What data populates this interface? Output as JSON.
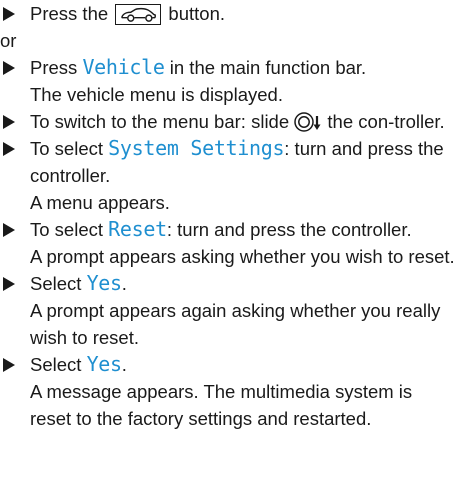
{
  "steps": [
    {
      "before": "Press the ",
      "icon": "car-icon",
      "after": " button."
    },
    {
      "or": "or"
    },
    {
      "before": "Press ",
      "ui": "Vehicle",
      "after": " in the main function bar.",
      "result": "The vehicle menu is displayed."
    },
    {
      "before": "To switch to the menu bar: slide ",
      "icon": "controller-slide-down-icon",
      "after": " the con-troller."
    },
    {
      "before": "To select ",
      "ui": "System Settings",
      "after": ": turn and press the controller.",
      "result": "A menu appears."
    },
    {
      "before": "To select ",
      "ui": "Reset",
      "after": ": turn and press the controller.",
      "result": "A prompt appears asking whether you wish to reset."
    },
    {
      "before": "Select ",
      "ui": "Yes",
      "after": ".",
      "result": "A prompt appears again asking whether you really wish to reset."
    },
    {
      "before": "Select ",
      "ui": "Yes",
      "after": ".",
      "result": "A message appears. The multimedia system is reset to the factory settings and restarted."
    }
  ],
  "colors": {
    "ui_text": "#1f8fd0",
    "body_text": "#1a1a1a"
  }
}
